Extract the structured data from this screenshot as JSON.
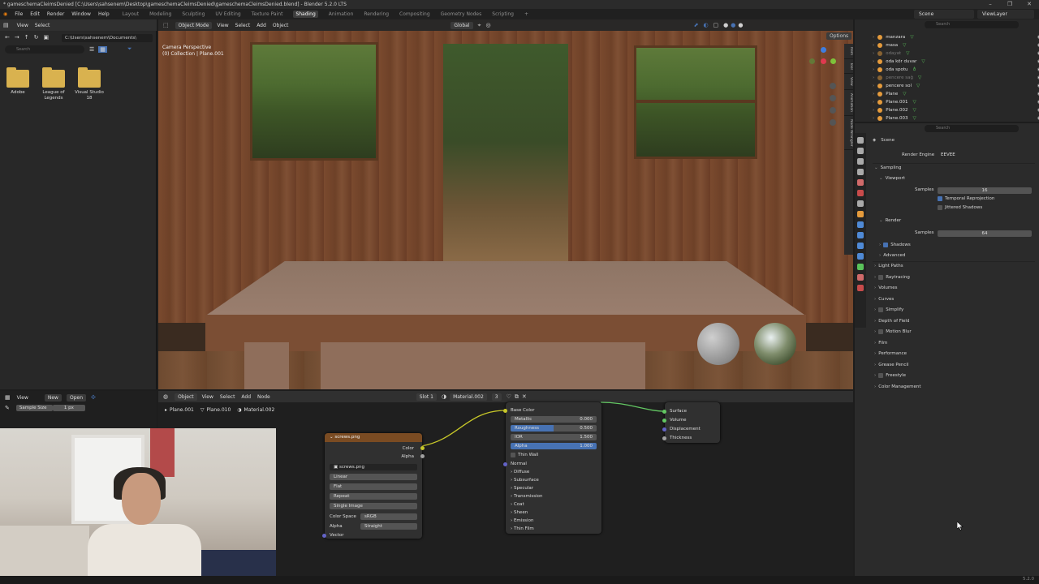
{
  "titlebar": {
    "title": "* gameschemaCleimsDenied [C:\\Users\\sahsenem\\Desktop\\gameschemaCleimsDenied\\gameschemaCleimsDenied.blend] - Blender 5.2.0 LTS",
    "minimize": "–",
    "restore": "❐",
    "close": "✕"
  },
  "menubar": {
    "items": [
      "File",
      "Edit",
      "Render",
      "Window",
      "Help"
    ],
    "workspaces": [
      "Layout",
      "Modeling",
      "Sculpting",
      "UV Editing",
      "Texture Paint",
      "Shading",
      "Animation",
      "Rendering",
      "Compositing",
      "Geometry Nodes",
      "Scripting"
    ],
    "active_workspace": "Shading",
    "add_tab": "+",
    "scene": "Scene",
    "view_layer": "ViewLayer"
  },
  "filebrowser": {
    "menus": [
      "View",
      "Select"
    ],
    "path": "C:\\Users\\sahsenem\\Documents\\",
    "search_placeholder": "Search",
    "folders": [
      {
        "label": "Adobe"
      },
      {
        "label": "League of Legends"
      },
      {
        "label": "Visual Studio 18"
      }
    ]
  },
  "viewport": {
    "mode": "Object Mode",
    "menus": [
      "View",
      "Select",
      "Add",
      "Object"
    ],
    "orientation": "Global",
    "options": "Options",
    "camera_label": "Camera Perspective",
    "collection_label": "(0) Collection | Plane.001",
    "side_tabs": [
      "Item",
      "Tool",
      "View",
      "Animation",
      "Node Wrangler"
    ]
  },
  "outliner": {
    "search_placeholder": "Search",
    "items": [
      {
        "name": "manzara",
        "dim": false
      },
      {
        "name": "masa",
        "dim": false
      },
      {
        "name": "odayat",
        "dim": true
      },
      {
        "name": "oda kör duvar",
        "dim": false
      },
      {
        "name": "oda spotu",
        "dim": false
      },
      {
        "name": "pencere sağ",
        "dim": true
      },
      {
        "name": "pencere sol",
        "dim": false
      },
      {
        "name": "Plane",
        "dim": false
      },
      {
        "name": "Plane.001",
        "dim": false
      },
      {
        "name": "Plane.002",
        "dim": false
      },
      {
        "name": "Plane.003",
        "dim": false
      }
    ]
  },
  "properties": {
    "search_placeholder": "Search",
    "scene_label": "Scene",
    "render_engine_label": "Render Engine",
    "render_engine": "EEVEE",
    "sampling": "Sampling",
    "viewport": "Viewport",
    "viewport_samples_label": "Samples",
    "viewport_samples": "16",
    "temporal_reprojection": "Temporal Reprojection",
    "jittered_shadows": "Jittered Shadows",
    "render": "Render",
    "render_samples_label": "Samples",
    "render_samples": "64",
    "shadows": "Shadows",
    "advanced": "Advanced",
    "panels": [
      "Light Paths",
      "Raytracing",
      "Volumes",
      "Curves",
      "Simplify",
      "Depth of Field",
      "Motion Blur",
      "Film",
      "Performance",
      "Grease Pencil",
      "Freestyle",
      "Color Management"
    ]
  },
  "tool_strip": {
    "menus": [
      "View"
    ],
    "new": "New",
    "open": "Open",
    "sample_size_label": "Sample Size",
    "sample_size": "1 px"
  },
  "node_editor": {
    "menus": [
      "Object",
      "View",
      "Select",
      "Add",
      "Node"
    ],
    "slot": "Slot 1",
    "material": "Material.002",
    "users": "3",
    "breadcrumb": [
      "Plane.001",
      "Plane.010",
      "Material.002"
    ],
    "image_node": {
      "title": "screws.png",
      "outputs": [
        "Color",
        "Alpha"
      ],
      "image": "screws.png",
      "interpolation": "Linear",
      "projection": "Flat",
      "extension": "Repeat",
      "source": "Single Image",
      "color_space_label": "Color Space",
      "color_space": "sRGB",
      "alpha_label": "Alpha",
      "alpha": "Straight",
      "vector": "Vector"
    },
    "bsdf_node": {
      "base_color": "Base Color",
      "metallic_label": "Metallic",
      "metallic": "0.000",
      "roughness_label": "Roughness",
      "roughness": "0.500",
      "ior_label": "IOR",
      "ior": "1.500",
      "alpha_label": "Alpha",
      "alpha": "1.000",
      "thin_wall": "Thin Wall",
      "normal": "Normal",
      "subpanels": [
        "Diffuse",
        "Subsurface",
        "Specular",
        "Transmission",
        "Coat",
        "Sheen",
        "Emission",
        "Thin Film"
      ]
    },
    "output_node": {
      "inputs": [
        "Surface",
        "Volume",
        "Displacement",
        "Thickness"
      ]
    }
  },
  "status": {
    "version": "5.2.0"
  },
  "colors": {
    "accent": "#4772b3",
    "active_header": "#3d3d3d",
    "folder": "#d9b24f",
    "link": "#c7c729",
    "shader_link": "#63c763"
  }
}
